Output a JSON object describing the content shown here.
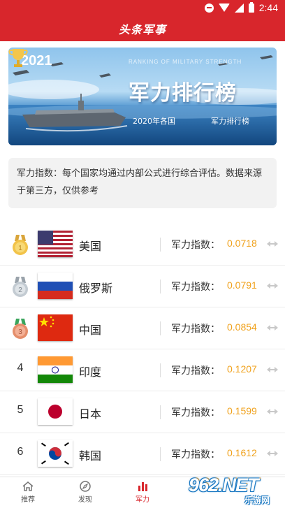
{
  "status_bar": {
    "time": "2:44"
  },
  "header": {
    "title": "头条军事"
  },
  "banner": {
    "year": "2021",
    "arc_text": "RANKING OF MILITARY STRENGTH",
    "title": "军力排行榜",
    "sub_left": "2020年各国",
    "sub_right": "军力排行榜"
  },
  "notice": {
    "text": "军力指数：每个国家均通过内部公式进行综合评估。数据来源于第三方，仅供参考"
  },
  "score_label": "军力指数：",
  "rankings": [
    {
      "rank": "1",
      "medal": "gold",
      "country": "美国",
      "flag": "us-flag-icon",
      "score": "0.0718"
    },
    {
      "rank": "2",
      "medal": "silver",
      "country": "俄罗斯",
      "flag": "russia-flag-icon",
      "score": "0.0791"
    },
    {
      "rank": "3",
      "medal": "bronze",
      "country": "中国",
      "flag": "china-flag-icon",
      "score": "0.0854"
    },
    {
      "rank": "4",
      "medal": "",
      "country": "印度",
      "flag": "india-flag-icon",
      "score": "0.1207"
    },
    {
      "rank": "5",
      "medal": "",
      "country": "日本",
      "flag": "japan-flag-icon",
      "score": "0.1599"
    },
    {
      "rank": "6",
      "medal": "",
      "country": "韩国",
      "flag": "korea-flag-icon",
      "score": "0.1612"
    }
  ],
  "bottom_nav": [
    {
      "label": "推荐",
      "icon": "home-icon",
      "active": false
    },
    {
      "label": "发现",
      "icon": "compass-icon",
      "active": false
    },
    {
      "label": "军力",
      "icon": "bar-chart-icon",
      "active": true
    }
  ],
  "watermark": {
    "logo": "962.NET",
    "sub": "乐游网"
  },
  "colors": {
    "brand_red": "#d8262c",
    "score_orange": "#f0a21d",
    "notice_bg": "#f2f2f2"
  }
}
